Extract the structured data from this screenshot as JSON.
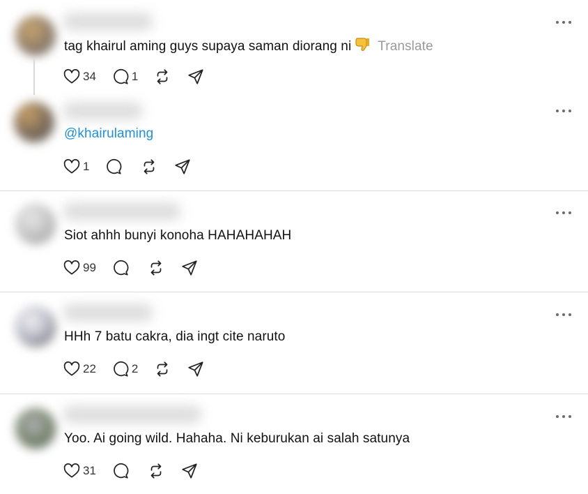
{
  "posts": [
    {
      "text": "tag khairul aming guys supaya saman diorang ni",
      "emoji": "👎",
      "translate_label": "Translate",
      "likes": "34",
      "replies": "1",
      "avatar_color": "#b8a07a"
    },
    {
      "text": "@khairulaming",
      "likes": "1",
      "replies": "",
      "avatar_color": "#a58a62"
    },
    {
      "text": "Siot ahhh bunyi konoha HAHAHAHAH",
      "likes": "99",
      "replies": "",
      "avatar_color": "#b7b7b7"
    },
    {
      "text": "HHh 7 batu cakra, dia ingt cite naruto",
      "likes": "22",
      "replies": "2",
      "avatar_color": "#9a9aa8"
    },
    {
      "text": "Yoo. Ai going wild. Hahaha. Ni keburukan ai salah satunya",
      "likes": "31",
      "replies": "",
      "avatar_color": "#8f9a86"
    }
  ],
  "icons": {
    "like": "heart-icon",
    "reply": "comment-icon",
    "repost": "repost-icon",
    "share": "share-icon",
    "more": "more-options-icon"
  },
  "colors": {
    "mention": "#1d8fe0",
    "translate": "#999999",
    "divider": "#dcdcdc"
  }
}
